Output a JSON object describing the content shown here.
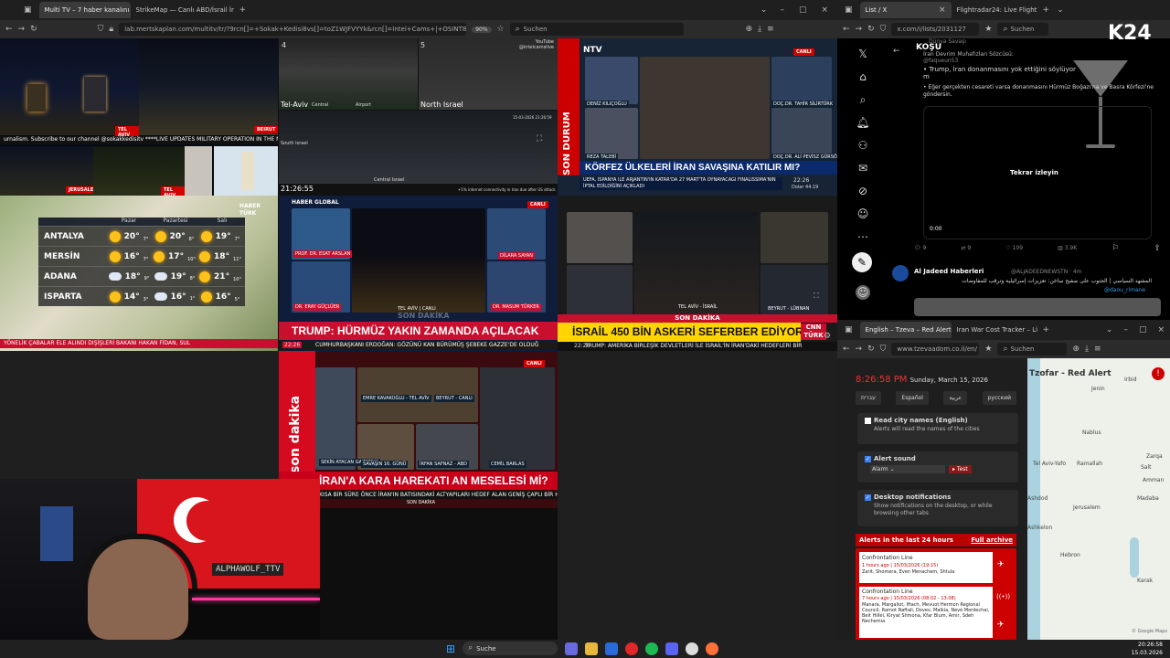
{
  "left_browser": {
    "tabs": [
      "Multi TV – 7 haber kanalını aynı",
      "StrikeMap — Canlı ABD/İsrail İr"
    ],
    "url": "lab.mertskaplan.com/multitv/tr/?9rcn[]=+Sokak+Kedisi8vs[]=toZ1WJFVYYk&rcn[]=Intel+Cams+|+OSINT8vs[]=4E-iFtUM2kk&",
    "zoom": "90%",
    "search_placeholder": "Suchen"
  },
  "cam_grid": {
    "ticker": "urnalism. Subscribe to our channel @sokakkedisitv   ****LIVE UPDATES MILITARY OPERATION IN THE MIDDLE EAST",
    "labels": [
      "TEL AVIV",
      "BEIRUT",
      "JERUSALEM",
      "TEL AVIV"
    ]
  },
  "intel_cams": {
    "numbers": [
      "4",
      "5"
    ],
    "youtube": "YouTube",
    "handle": "@intelcamslive",
    "labels": [
      "Tel-Aviv",
      "Central",
      "Airport",
      "North Israel",
      "South Israel",
      "Central Israel"
    ],
    "datetime": "15-03-2026 21:26:59",
    "clock": "21:26:55",
    "ticker": "+1% internet connectivity in Iran due after US attack"
  },
  "ntv": {
    "logo": "NTV",
    "live": "CANLI",
    "side": "SON DURUM",
    "names": [
      "DENİZ KILIÇOĞLU",
      "DOÇ.DR. TAHİR SİLİRTÜRK",
      "REZA TALEBİ",
      "DOÇ.DR. ALİ PEVİSZ GÜRSÖN"
    ],
    "headline": "KÖRFEZ ÜLKELERİ İRAN SAVAŞINA KATILIR MI?",
    "ticker": "UEFA, İSPANYA İLE ARJANTİN'İN KATAR'DA 27 MART'TA OYNAYACAĞI FİNALİSSİMA'NIN İPTAL EDİLDİĞİNİ AÇIKLADI",
    "time": "22:26",
    "extra": "Dolar 44.19"
  },
  "weather": {
    "channel": "HABER TÜRK",
    "days": [
      "Pazar",
      "Pazartesi",
      "Salı"
    ],
    "rows": [
      {
        "city": "ANTALYA",
        "t": [
          "20°",
          "20°",
          "19°"
        ],
        "low": [
          "7°",
          "8°",
          "7°"
        ],
        "icons": [
          "sun",
          "sun",
          "sun"
        ]
      },
      {
        "city": "MERSİN",
        "t": [
          "16°",
          "17°",
          "18°"
        ],
        "low": [
          "7°",
          "10°",
          "11°"
        ],
        "icons": [
          "sun",
          "sun",
          "sun"
        ]
      },
      {
        "city": "ADANA",
        "t": [
          "18°",
          "19°",
          "21°"
        ],
        "low": [
          "9°",
          "8°",
          "10°"
        ],
        "icons": [
          "cloud",
          "cloud",
          "sun"
        ]
      },
      {
        "city": "ISPARTA",
        "t": [
          "14°",
          "16°",
          "16°"
        ],
        "low": [
          "3°",
          "1°",
          "5°"
        ],
        "icons": [
          "sun",
          "cloud",
          "sun"
        ]
      }
    ],
    "ticker": "YÖNELİK ÇABALAR ELE ALINDI   DIŞİŞLERİ BAKANI HAKAN FİDAN, SUL"
  },
  "haber_global": {
    "logo": "HABER GLOBAL",
    "live": "CANLI",
    "names": [
      "PROF. DR. ESAT ARSLAN",
      "DİLARA SAYAN",
      "DR. ERAY GÜÇLÜER",
      "DR. MASUM TÜRKER"
    ],
    "center": "TEL AVİV | CANLI",
    "banner": "SON DAKİKA",
    "headline": "TRUMP: HÜRMÜZ YAKIN ZAMANDA AÇILACAK",
    "ticker": "CUMHURBAŞKANI ERDOĞAN: GÖZÜNÜ KAN BÜRÜMÜŞ ŞEBEKE GAZZE'DE OLDUĞ",
    "time": "22:26"
  },
  "cnn": {
    "banner": "SON DAKİKA",
    "headline": "İSRAİL 450 BİN ASKERİ SEFERBER EDİYOR",
    "logo": "CNN TÜRK",
    "ticker": "TRUMP: AMERİKA BİRLEŞİK DEVLETLERİ İLE İSRAİL'İN İRAN'DAKİ HEDEFLERİ BİR",
    "time": "22:26",
    "names": [
      "TEL AVİV - İSRAİL",
      "BEYRUT - LÜBNAN"
    ]
  },
  "a_haber": {
    "side": "son dakika",
    "live": "CANLI",
    "names": [
      "SEKİN ATACAN GAZETECİ",
      "EMRE KAVAKOĞLU - TEL AVİV",
      "BEYRUT - CANLI",
      "SAVAŞIN 16. GÜNÜ",
      "İRFAN SAFNAZ - ABD",
      "CEMİL BARLAS"
    ],
    "headline": "İRAN'A KARA HAREKATI AN MESELESİ Mİ?",
    "ticker": "KISA BİR SÜRE ÖNCE İRAN'IN BATISINDAKİ ALTYAPILARI HEDEF ALAN GENİŞ ÇAPLI BİR HAVA SALDIRI",
    "banner": "SON DAKİKA"
  },
  "streamer": {
    "name": "ALPHAWOLF_TTV"
  },
  "x_window": {
    "tabs": [
      "List / X",
      "Flightradar24: Live Flight Tr"
    ],
    "url": "x.com/i/lists/2031127",
    "search": "Suchen",
    "logo": "K24",
    "post_author": "Dünya Savaşı",
    "post_handle": "@faqueun53",
    "post_title": "KOŞU",
    "post_sub": "İran Devrim Muhafızları Sözcüsü:",
    "bullet1": "Trump, İran donanmasını yok ettiğini söylüyor m",
    "bullet2": "Eğer gerçekten cesareti varsa donanmasını Hürmüz Boğazı'na ve Basra Körfezi'ne göndersin.",
    "replay": "Tekrar izleyin",
    "video_time": "0:00",
    "stats": [
      "9",
      "9",
      "109",
      "3.9K"
    ],
    "post2_author": "Al Jadeed Haberleri",
    "post2_handle": "@ALJADEEDNEWSTN · 4m",
    "post2_text": "المشهد السياسي | الجنوب على صفيح ساخن: تعزيزات إسرائيلية وترقب للمفاوضات",
    "post2_tag": "@daou_rimane"
  },
  "alert_window": {
    "tabs": [
      "English – Tzeva – Red Alert",
      "Iran War Cost Tracker – Li"
    ],
    "url": "www.tzevaadom.co.il/en/",
    "search": "Suchen",
    "time": "8:26:58 PM",
    "date": "Sunday, March 15, 2026",
    "langs": [
      "עברית",
      "Español",
      "عربية",
      "русский"
    ],
    "opt1_title": "Read city names (English)",
    "opt1_desc": "Alerts will read the names of the cities",
    "opt2_title": "Alert sound",
    "sound_value": "Alarm",
    "test_label": "Test",
    "opt3_title": "Desktop notifications",
    "opt3_desc": "Show notifications on the desktop, or while browsing other tabs",
    "alerts_header": "Alerts in the last 24 hours",
    "full_archive": "Full archive",
    "alerts": [
      {
        "title": "Confrontation Line",
        "time": "1 hours ago | 15/03/2026 (19:15)",
        "places": "Zarit, Shomera, Even Menachem, Shtula"
      },
      {
        "title": "Confrontation Line",
        "time": "7 hours ago | 15/03/2026 (08:02 - 13:08)",
        "places": "Manara, Margaliot, Iftach, Mevuot Hermon Regional Council, Ramot Naftali, Dovev, Malkia, Nevé Mordechai, Beit Hillel, Kiryat Shmona, Kfar Blum, Amir, Sdeh Nechemia"
      }
    ],
    "map_title": "Tzofar - Red Alert",
    "map_places": [
      "Tel Aviv-Yafo",
      "Ramallah",
      "Jerusalem",
      "Hebron",
      "Nablus",
      "Jenin",
      "Irbid",
      "Amman",
      "Zarqa",
      "Madaba",
      "Karak",
      "Salt",
      "Ashdod",
      "Ashkelon"
    ],
    "map_attr": "© Google Maps"
  },
  "taskbar": {
    "search": "Suche",
    "time": "20:26:58",
    "date": "15.03.2026"
  },
  "colors": {
    "red": "#d40000",
    "haber_red": "#c8102e",
    "ntv_blue": "#0b2a6b",
    "yellow": "#ffd400"
  }
}
